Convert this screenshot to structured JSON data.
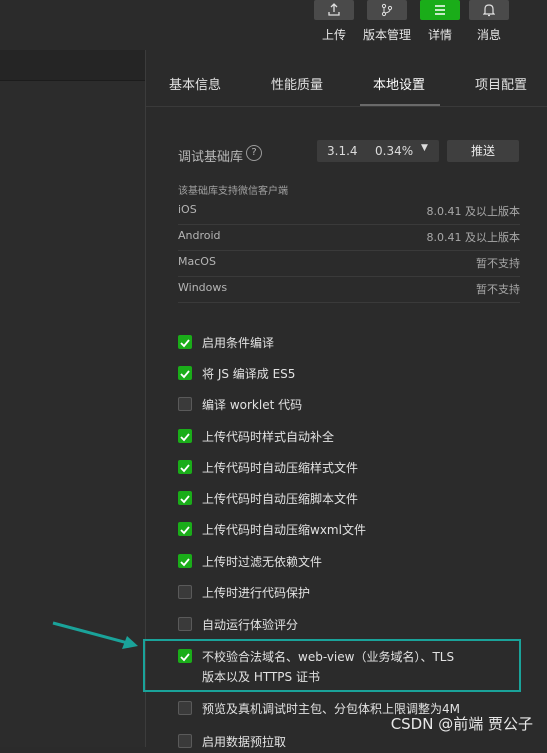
{
  "toolbar": {
    "upload_label": "上传",
    "version_label": "版本管理",
    "details_label": "详情",
    "messages_label": "消息"
  },
  "tabs": {
    "basic": "基本信息",
    "performance": "性能质量",
    "local": "本地设置",
    "project": "项目配置"
  },
  "library": {
    "label": "调试基础库",
    "help": "?",
    "version": "3.1.4",
    "percent": "0.34%",
    "push": "推送",
    "note": "该基础库支持微信客户端"
  },
  "os_support": [
    {
      "name": "iOS",
      "version": "8.0.41 及以上版本"
    },
    {
      "name": "Android",
      "version": "8.0.41 及以上版本"
    },
    {
      "name": "MacOS",
      "version": "暂不支持"
    },
    {
      "name": "Windows",
      "version": "暂不支持"
    }
  ],
  "options": [
    {
      "label": "启用条件编译",
      "checked": true
    },
    {
      "label": "将 JS 编译成 ES5",
      "checked": true
    },
    {
      "label": "编译 worklet 代码",
      "checked": false
    },
    {
      "label": "上传代码时样式自动补全",
      "checked": true
    },
    {
      "label": "上传代码时自动压缩样式文件",
      "checked": true
    },
    {
      "label": "上传代码时自动压缩脚本文件",
      "checked": true
    },
    {
      "label": "上传代码时自动压缩wxml文件",
      "checked": true
    },
    {
      "label": "上传时过滤无依赖文件",
      "checked": true
    },
    {
      "label": "上传时进行代码保护",
      "checked": false
    },
    {
      "label": "自动运行体验评分",
      "checked": false
    },
    {
      "label": "不校验合法域名、web-view（业务域名）、TLS",
      "label2": "版本以及 HTTPS 证书",
      "checked": true
    },
    {
      "label": "预览及真机调试时主包、分包体积上限调整为4M",
      "checked": false
    },
    {
      "label": "启用数据预拉取",
      "checked": false
    }
  ],
  "watermark": "CSDN @前端 贾公子",
  "colors": {
    "accent": "#1aad19",
    "annotation": "#1aa39a"
  }
}
